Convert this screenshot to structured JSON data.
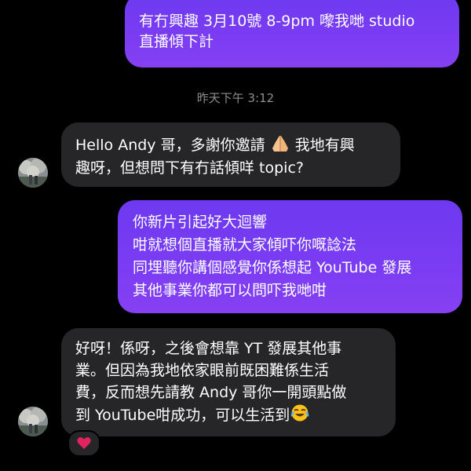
{
  "conversation": {
    "messages": [
      {
        "direction": "outgoing",
        "lines": [
          "有冇興趣 3月10號 8-9pm 嚟我哋 studio",
          "直播傾下計"
        ]
      },
      {
        "direction": "incoming",
        "lines": [
          "Hello Andy 哥，多謝你邀請",
          "我地有興",
          "趣呀，但想問下有冇話傾咩 topic?"
        ],
        "emoji": "folded-hands-emoji"
      },
      {
        "direction": "outgoing",
        "lines": [
          "你新片引起好大迴響",
          "咁就想個直播就大家傾吓你嘅諗法",
          "同埋聽你講個感覺你係想起 YouTube 發展",
          "其他事業你都可以問吓我哋咁"
        ]
      },
      {
        "direction": "incoming",
        "lines": [
          "好呀！係呀，之後會想靠 YT 發展其他事",
          "業。但因為我地依家眼前既困難係生活",
          "費，反而想先請教 Andy 哥你一開頭點做",
          "到 YouTube咁成功，可以生活到"
        ],
        "emoji": "tears-of-joy-emoji",
        "reaction": "red-heart-icon"
      }
    ],
    "timestamp": "昨天下午 3:12"
  },
  "colors": {
    "background": "#000000",
    "outgoing_bubble": "#7a3cf2",
    "incoming_bubble": "#262629",
    "timestamp_text": "#8e8e93",
    "text": "#ffffff",
    "heart": "#e0245e"
  }
}
